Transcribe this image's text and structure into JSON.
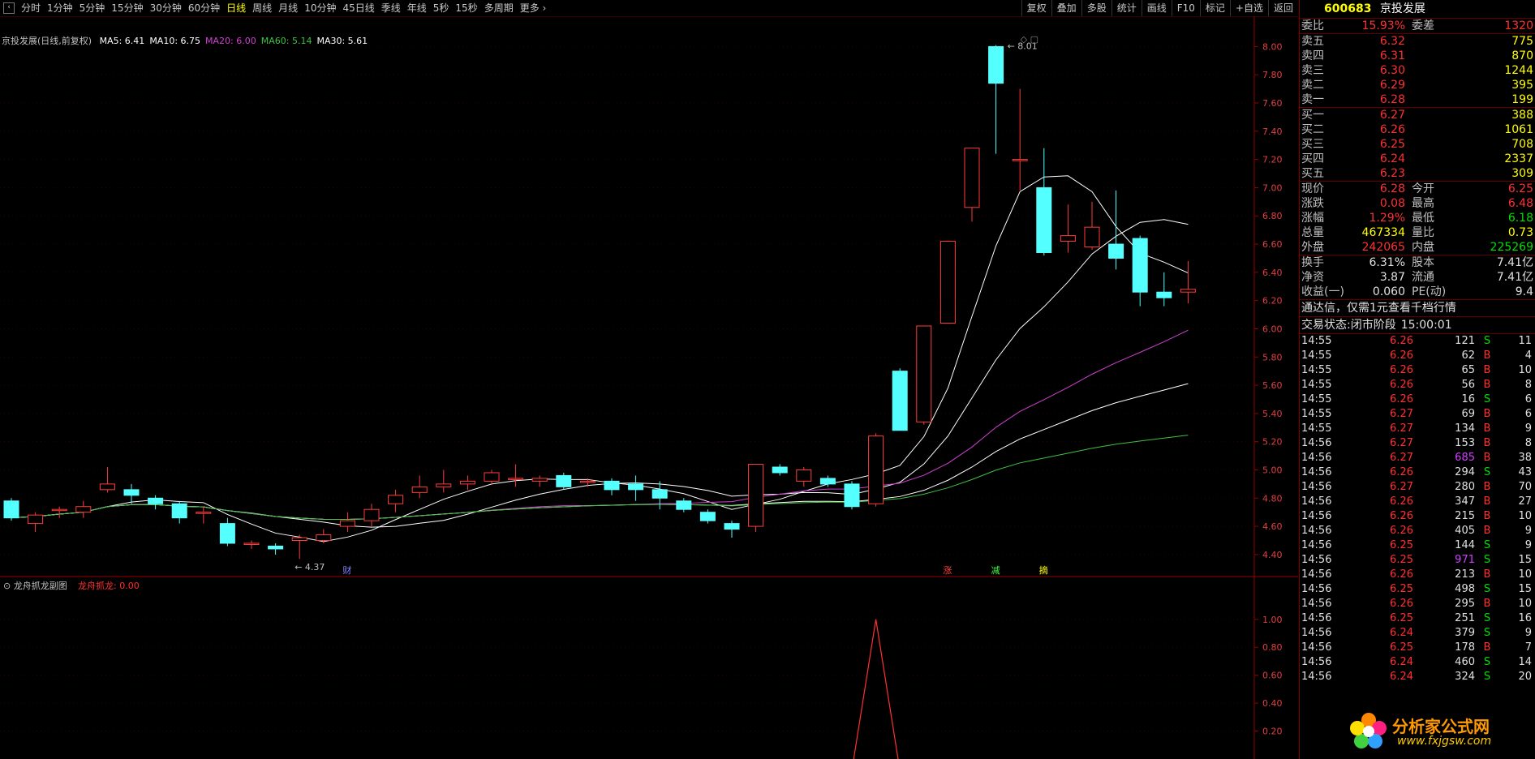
{
  "toolbar": {
    "back_icon": "back-arrow-icon",
    "periods": [
      "分时",
      "1分钟",
      "5分钟",
      "15分钟",
      "30分钟",
      "60分钟",
      "日线",
      "周线",
      "月线",
      "10分钟",
      "45日线",
      "季线",
      "年线",
      "5秒",
      "15秒",
      "多周期",
      "更多"
    ],
    "active_period": "日线",
    "right_buttons": [
      "复权",
      "叠加",
      "多股",
      "统计",
      "画线",
      "F10",
      "标记",
      "+自选",
      "返回"
    ]
  },
  "main": {
    "title": "京投发展(日线,前复权)",
    "ma": [
      {
        "label": "MA5: 6.41",
        "color": "#ffffff"
      },
      {
        "label": "MA10: 6.75",
        "color": "#ffffff"
      },
      {
        "label": "MA20: 6.00",
        "color": "#d040d0"
      },
      {
        "label": "MA60: 5.14",
        "color": "#40c040"
      },
      {
        "label": "MA30: 5.61",
        "color": "#ffffff"
      }
    ],
    "high_label": "8.01",
    "low_label": "4.37",
    "markers": [
      {
        "text": "财",
        "color": "#8080ff"
      },
      {
        "text": "涨",
        "color": "#ff4040"
      },
      {
        "text": "减",
        "color": "#40ff40"
      },
      {
        "text": "摘",
        "color": "#ffff00"
      }
    ],
    "y_ticks": [
      "8.00",
      "7.80",
      "7.60",
      "7.40",
      "7.20",
      "7.00",
      "6.80",
      "6.60",
      "6.40",
      "6.20",
      "6.00",
      "5.80",
      "5.60",
      "5.40",
      "5.20",
      "5.00",
      "4.80",
      "4.60",
      "4.40"
    ]
  },
  "sub": {
    "title": "龙舟抓龙副图",
    "value_label": "龙舟抓龙: 0.00",
    "y_ticks": [
      "1.00",
      "0.80",
      "0.60",
      "0.40",
      "0.20"
    ]
  },
  "chart_data": {
    "type": "candlestick",
    "ylim": [
      4.25,
      8.1
    ],
    "candles": [
      [
        4.78,
        4.66,
        4.8,
        4.64
      ],
      [
        4.62,
        4.68,
        4.7,
        4.56
      ],
      [
        4.72,
        4.72,
        4.74,
        4.66
      ],
      [
        4.7,
        4.74,
        4.78,
        4.66
      ],
      [
        4.86,
        4.9,
        5.02,
        4.84
      ],
      [
        4.86,
        4.82,
        4.9,
        4.76
      ],
      [
        4.8,
        4.76,
        4.82,
        4.72
      ],
      [
        4.76,
        4.66,
        4.78,
        4.62
      ],
      [
        4.7,
        4.7,
        4.74,
        4.62
      ],
      [
        4.62,
        4.48,
        4.66,
        4.46
      ],
      [
        4.48,
        4.48,
        4.5,
        4.44
      ],
      [
        4.46,
        4.44,
        4.48,
        4.4
      ],
      [
        4.5,
        4.52,
        4.54,
        4.37
      ],
      [
        4.5,
        4.54,
        4.58,
        4.48
      ],
      [
        4.6,
        4.64,
        4.7,
        4.56
      ],
      [
        4.64,
        4.72,
        4.76,
        4.6
      ],
      [
        4.76,
        4.82,
        4.86,
        4.7
      ],
      [
        4.84,
        4.88,
        4.96,
        4.8
      ],
      [
        4.88,
        4.9,
        5.0,
        4.84
      ],
      [
        4.9,
        4.92,
        4.96,
        4.86
      ],
      [
        4.92,
        4.98,
        5.0,
        4.9
      ],
      [
        4.94,
        4.94,
        5.04,
        4.88
      ],
      [
        4.92,
        4.94,
        4.96,
        4.88
      ],
      [
        4.96,
        4.88,
        4.98,
        4.86
      ],
      [
        4.92,
        4.92,
        4.94,
        4.88
      ],
      [
        4.92,
        4.86,
        4.94,
        4.82
      ],
      [
        4.9,
        4.86,
        4.96,
        4.78
      ],
      [
        4.86,
        4.8,
        4.92,
        4.72
      ],
      [
        4.78,
        4.72,
        4.8,
        4.7
      ],
      [
        4.7,
        4.64,
        4.72,
        4.62
      ],
      [
        4.62,
        4.58,
        4.64,
        4.52
      ],
      [
        4.6,
        5.04,
        5.04,
        4.56
      ],
      [
        5.02,
        4.98,
        5.04,
        4.96
      ],
      [
        4.92,
        5.0,
        5.02,
        4.88
      ],
      [
        4.94,
        4.9,
        4.96,
        4.88
      ],
      [
        4.9,
        4.74,
        4.92,
        4.72
      ],
      [
        4.76,
        5.24,
        5.26,
        4.74
      ],
      [
        5.7,
        5.28,
        5.72,
        5.3
      ],
      [
        5.34,
        6.02,
        6.02,
        5.32
      ],
      [
        6.04,
        6.62,
        6.62,
        6.04
      ],
      [
        6.86,
        7.28,
        7.28,
        6.76
      ],
      [
        8.0,
        7.74,
        8.01,
        7.24
      ],
      [
        7.2,
        7.2,
        7.7,
        6.98
      ],
      [
        7.0,
        6.54,
        7.28,
        6.52
      ],
      [
        6.62,
        6.66,
        6.88,
        6.54
      ],
      [
        6.58,
        6.72,
        6.9,
        6.56
      ],
      [
        6.6,
        6.5,
        6.98,
        6.42
      ],
      [
        6.64,
        6.26,
        6.66,
        6.16
      ],
      [
        6.26,
        6.22,
        6.4,
        6.16
      ],
      [
        6.26,
        6.28,
        6.48,
        6.18
      ]
    ],
    "ma_series": [
      {
        "name": "MA5",
        "color": "#ffffff"
      },
      {
        "name": "MA10",
        "color": "#ffffff"
      },
      {
        "name": "MA20",
        "color": "#d040d0"
      },
      {
        "name": "MA30",
        "color": "#ffffff"
      },
      {
        "name": "MA60",
        "color": "#40c040"
      }
    ],
    "sub_signal": {
      "peak_index": 36,
      "value": 1.0,
      "ylim": [
        0,
        1.08
      ]
    }
  },
  "quote": {
    "code": "600683",
    "name": "京投发展",
    "weibi_label": "委比",
    "weibi": "15.93%",
    "weicha_label": "委差",
    "weicha": "1320",
    "asks": [
      {
        "label": "卖五",
        "price": "6.32",
        "vol": "775"
      },
      {
        "label": "卖四",
        "price": "6.31",
        "vol": "870"
      },
      {
        "label": "卖三",
        "price": "6.30",
        "vol": "1244"
      },
      {
        "label": "卖二",
        "price": "6.29",
        "vol": "395"
      },
      {
        "label": "卖一",
        "price": "6.28",
        "vol": "199"
      }
    ],
    "bids": [
      {
        "label": "买一",
        "price": "6.27",
        "vol": "388"
      },
      {
        "label": "买二",
        "price": "6.26",
        "vol": "1061"
      },
      {
        "label": "买三",
        "price": "6.25",
        "vol": "708"
      },
      {
        "label": "买四",
        "price": "6.24",
        "vol": "2337"
      },
      {
        "label": "买五",
        "price": "6.23",
        "vol": "309"
      }
    ],
    "stats": [
      {
        "l1": "现价",
        "v1": "6.28",
        "c1": "red",
        "l2": "今开",
        "v2": "6.25",
        "c2": "red"
      },
      {
        "l1": "涨跌",
        "v1": "0.08",
        "c1": "red",
        "l2": "最高",
        "v2": "6.48",
        "c2": "red"
      },
      {
        "l1": "涨幅",
        "v1": "1.29%",
        "c1": "red",
        "l2": "最低",
        "v2": "6.18",
        "c2": "green"
      },
      {
        "l1": "总量",
        "v1": "467334",
        "c1": "yellow",
        "l2": "量比",
        "v2": "0.73",
        "c2": "yellow"
      },
      {
        "l1": "外盘",
        "v1": "242065",
        "c1": "red",
        "l2": "内盘",
        "v2": "225269",
        "c2": "green"
      }
    ],
    "stats2": [
      {
        "l1": "换手",
        "v1": "6.31%",
        "l2": "股本",
        "v2": "7.41亿"
      },
      {
        "l1": "净资",
        "v1": "3.87",
        "l2": "流通",
        "v2": "7.41亿"
      },
      {
        "l1": "收益(一)",
        "v1": "0.060",
        "l2": "PE(动)",
        "v2": "9.4"
      }
    ],
    "notice": "通达信，仅需1元查看千档行情",
    "trade_status_label": "交易状态:",
    "trade_status": "闭市阶段",
    "trade_time": "15:00:01"
  },
  "ticks": [
    {
      "t": "14:55",
      "p": "6.26",
      "v": "121",
      "d": "S",
      "n": "11",
      "pc": "red",
      "vc": "white"
    },
    {
      "t": "14:55",
      "p": "6.26",
      "v": "62",
      "d": "B",
      "n": "4",
      "pc": "red",
      "vc": "white"
    },
    {
      "t": "14:55",
      "p": "6.26",
      "v": "65",
      "d": "B",
      "n": "10",
      "pc": "red",
      "vc": "white"
    },
    {
      "t": "14:55",
      "p": "6.26",
      "v": "56",
      "d": "B",
      "n": "8",
      "pc": "red",
      "vc": "white"
    },
    {
      "t": "14:55",
      "p": "6.26",
      "v": "16",
      "d": "S",
      "n": "6",
      "pc": "red",
      "vc": "white"
    },
    {
      "t": "14:55",
      "p": "6.27",
      "v": "69",
      "d": "B",
      "n": "6",
      "pc": "red",
      "vc": "white"
    },
    {
      "t": "14:55",
      "p": "6.27",
      "v": "134",
      "d": "B",
      "n": "9",
      "pc": "red",
      "vc": "white"
    },
    {
      "t": "14:56",
      "p": "6.27",
      "v": "153",
      "d": "B",
      "n": "8",
      "pc": "red",
      "vc": "white"
    },
    {
      "t": "14:56",
      "p": "6.27",
      "v": "685",
      "d": "B",
      "n": "38",
      "pc": "red",
      "vc": "purple"
    },
    {
      "t": "14:56",
      "p": "6.26",
      "v": "294",
      "d": "S",
      "n": "43",
      "pc": "red",
      "vc": "white"
    },
    {
      "t": "14:56",
      "p": "6.27",
      "v": "280",
      "d": "B",
      "n": "70",
      "pc": "red",
      "vc": "white"
    },
    {
      "t": "14:56",
      "p": "6.26",
      "v": "347",
      "d": "B",
      "n": "27",
      "pc": "red",
      "vc": "white"
    },
    {
      "t": "14:56",
      "p": "6.26",
      "v": "215",
      "d": "B",
      "n": "10",
      "pc": "red",
      "vc": "white"
    },
    {
      "t": "14:56",
      "p": "6.26",
      "v": "405",
      "d": "B",
      "n": "9",
      "pc": "red",
      "vc": "white"
    },
    {
      "t": "14:56",
      "p": "6.25",
      "v": "144",
      "d": "S",
      "n": "9",
      "pc": "red",
      "vc": "white"
    },
    {
      "t": "14:56",
      "p": "6.25",
      "v": "971",
      "d": "S",
      "n": "15",
      "pc": "red",
      "vc": "purple"
    },
    {
      "t": "14:56",
      "p": "6.26",
      "v": "213",
      "d": "B",
      "n": "10",
      "pc": "red",
      "vc": "white"
    },
    {
      "t": "14:56",
      "p": "6.25",
      "v": "498",
      "d": "S",
      "n": "15",
      "pc": "red",
      "vc": "white"
    },
    {
      "t": "14:56",
      "p": "6.26",
      "v": "295",
      "d": "B",
      "n": "10",
      "pc": "red",
      "vc": "white"
    },
    {
      "t": "14:56",
      "p": "6.25",
      "v": "251",
      "d": "S",
      "n": "16",
      "pc": "red",
      "vc": "white"
    },
    {
      "t": "14:56",
      "p": "6.24",
      "v": "379",
      "d": "S",
      "n": "9",
      "pc": "red",
      "vc": "white"
    },
    {
      "t": "14:56",
      "p": "6.25",
      "v": "178",
      "d": "B",
      "n": "7",
      "pc": "red",
      "vc": "white"
    },
    {
      "t": "14:56",
      "p": "6.24",
      "v": "460",
      "d": "S",
      "n": "14",
      "pc": "red",
      "vc": "white"
    },
    {
      "t": "14:56",
      "p": "6.24",
      "v": "324",
      "d": "S",
      "n": "20",
      "pc": "red",
      "vc": "white"
    }
  ],
  "watermark": {
    "text": "分析家公式网",
    "url": "www.fxjgsw.com"
  }
}
